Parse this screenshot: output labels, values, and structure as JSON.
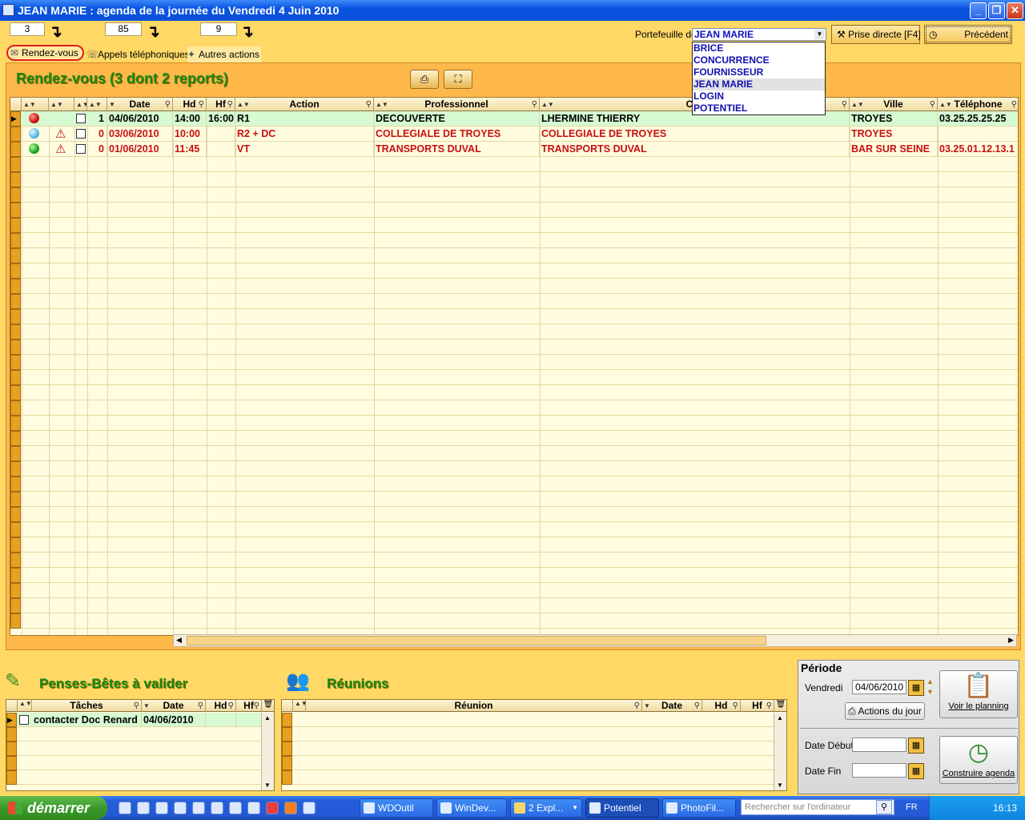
{
  "window": {
    "title": "JEAN MARIE : agenda de la journée du Vendredi 4 Juin 2010",
    "controls": {
      "minimize": "_",
      "maximize": "❐",
      "close": "✕"
    }
  },
  "counters": [
    {
      "value": "3"
    },
    {
      "value": "85"
    },
    {
      "value": "9"
    }
  ],
  "tabs": {
    "rdv": "Rendez-vous",
    "appels": "Appels téléphoniques",
    "autres": "Autres actions"
  },
  "portefeuille": {
    "label": "Portefeuille de",
    "selected": "JEAN MARIE",
    "options": [
      "BRICE",
      "CONCURRENCE",
      "FOURNISSEUR",
      "JEAN MARIE",
      "LOGIN",
      "POTENTIEL"
    ]
  },
  "toolbar": {
    "prise_directe": "Prise directe [F4]",
    "precedent": "Précédent"
  },
  "rdv": {
    "title": "Rendez-vous (3 dont 2 reports)",
    "columns": {
      "date": "Date",
      "hd": "Hd",
      "hf": "Hf",
      "action": "Action",
      "professionnel": "Professionnel",
      "contact": "Cor",
      "ville": "Ville",
      "telephone": "Téléphone"
    },
    "rows": [
      {
        "status": "red",
        "warning": false,
        "count": "1",
        "date": "04/06/2010",
        "hd": "14:00",
        "hf": "16:00",
        "action": "R1",
        "professionnel": "DECOUVERTE",
        "contact": "LHERMINE THIERRY",
        "ville": "TROYES",
        "telephone": "03.25.25.25.25",
        "highlight": false
      },
      {
        "status": "blue",
        "warning": true,
        "count": "0",
        "date": "03/06/2010",
        "hd": "10:00",
        "hf": "",
        "action": "R2 + DC",
        "professionnel": "COLLEGIALE DE TROYES",
        "contact": "COLLEGIALE DE TROYES",
        "ville": "TROYES",
        "telephone": "",
        "highlight": true
      },
      {
        "status": "green",
        "warning": true,
        "count": "0",
        "date": "01/06/2010",
        "hd": "11:45",
        "hf": "",
        "action": "VT",
        "professionnel": "TRANSPORTS DUVAL",
        "contact": "TRANSPORTS DUVAL",
        "ville": "BAR SUR SEINE",
        "telephone": "03.25.01.12.13.1",
        "highlight": true
      }
    ]
  },
  "pensebetes": {
    "title": "Penses-Bêtes à valider",
    "columns": {
      "taches": "Tâches",
      "date": "Date",
      "hd": "Hd",
      "hf": "Hf"
    },
    "rows": [
      {
        "tache": "contacter Doc Renard",
        "date": "04/06/2010",
        "hd": "",
        "hf": ""
      }
    ]
  },
  "reunions": {
    "title": "Réunions",
    "columns": {
      "reunion": "Réunion",
      "date": "Date",
      "hd": "Hd",
      "hf": "Hf"
    }
  },
  "periode": {
    "title": "Période",
    "day_label": "Vendredi",
    "date": "04/06/2010",
    "actions_du_jour": "Actions du jour",
    "voir_planning": "Voir le planning",
    "date_debut_label": "Date Début",
    "date_fin_label": "Date Fin",
    "date_debut": "",
    "date_fin": "",
    "construire": "Construire agenda"
  },
  "taskbar": {
    "start": "démarrer",
    "tasks": [
      "WDOutil",
      "WinDev...",
      "2 Expl...",
      "Potentiel",
      "PhotoFil..."
    ],
    "search_placeholder": "Rechercher sur l'ordinateur",
    "lang": "FR",
    "clock": "16:13"
  },
  "colors": {
    "background": "#FFD866",
    "panel": "#FFB84A",
    "title_green": "#138a13",
    "row_selected": "#D7FAD2",
    "late_red": "#c81010"
  }
}
